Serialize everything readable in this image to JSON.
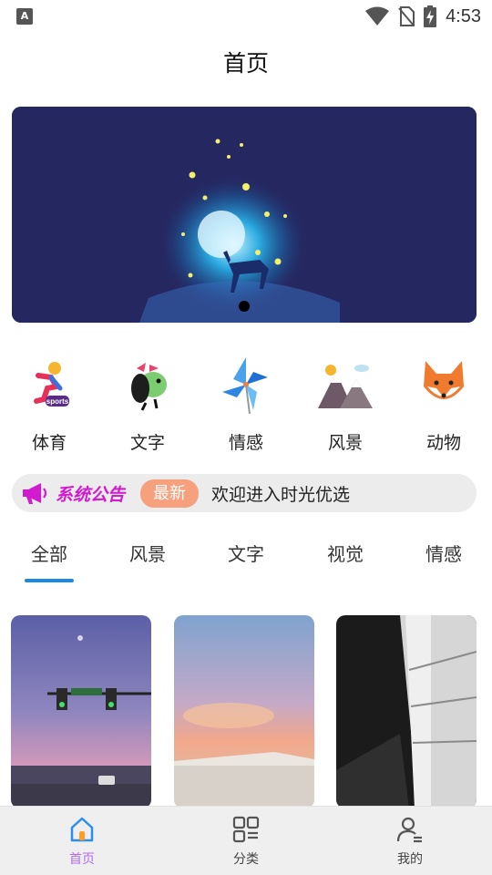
{
  "status_bar": {
    "time": "4:53"
  },
  "header": {
    "title": "首页"
  },
  "categories": [
    {
      "label": "体育",
      "icon": "sports-icon"
    },
    {
      "label": "文字",
      "icon": "text-dino-icon"
    },
    {
      "label": "情感",
      "icon": "pinwheel-icon"
    },
    {
      "label": "风景",
      "icon": "mountain-icon"
    },
    {
      "label": "动物",
      "icon": "fox-icon"
    }
  ],
  "notice": {
    "title": "系统公告",
    "badge": "最新",
    "text": "欢迎进入时光优选"
  },
  "tabs": [
    {
      "label": "全部",
      "active": true
    },
    {
      "label": "风景",
      "active": false
    },
    {
      "label": "文字",
      "active": false
    },
    {
      "label": "视觉",
      "active": false
    },
    {
      "label": "情感",
      "active": false
    }
  ],
  "cards": [
    {
      "icon": "street-photo"
    },
    {
      "icon": "sunset-building-photo"
    },
    {
      "icon": "subway-station-photo"
    }
  ],
  "bottom_nav": [
    {
      "label": "首页",
      "icon": "home-icon",
      "active": true
    },
    {
      "label": "分类",
      "icon": "category-icon",
      "active": false
    },
    {
      "label": "我的",
      "icon": "user-icon",
      "active": false
    }
  ],
  "colors": {
    "accent": "#1e88e5",
    "nav_active": "#b06cf0",
    "notice_title": "#d21bd0",
    "badge_bg": "#f6a07d",
    "banner_bg": "#252760"
  }
}
